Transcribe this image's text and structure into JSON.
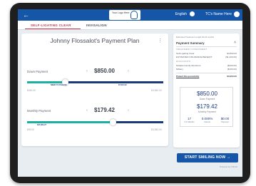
{
  "header": {
    "logo_text": "Your Logo Here",
    "language": "English",
    "user_name": "TC's Name Here"
  },
  "tabs": [
    {
      "label": "SELF-LIGATING CLEAR"
    },
    {
      "label": "INVISALIGN"
    }
  ],
  "plan": {
    "title": "Johnny Flossalot's Payment Plan",
    "down_payment": {
      "label": "Down Payment",
      "value": "$850.00",
      "fill_fraction": 0.28,
      "bar_label_left": "NEED TO PLEASE",
      "bar_label_right": "$7,010.93",
      "min": "$250.00",
      "max": "$3,950.00"
    },
    "monthly_payment": {
      "label": "Monthly Payment",
      "value": "$179.42",
      "fill_fraction": 0.63,
      "bar_label_left": "$47,903.27",
      "min": "$99.00",
      "max": "$3,950.00"
    }
  },
  "summary": {
    "note": "Estimated Treatment Length 18-24 months",
    "title": "Payment Summary",
    "treatment_heading": "TREATMENT INVESTMENT",
    "rows": [
      {
        "label": "Self-Ligating Clear",
        "value": "$3,800.00"
      },
      {
        "label": "ESTIMATED INSURANCE BENEFIT",
        "value": "($1,200.00)"
      }
    ],
    "discounts_heading": "DISCOUNTS",
    "discount_rows": [
      {
        "label": "Multiple Family Members",
        "value": "($100.00)"
      },
      {
        "label": "Military",
        "value": "($150.00)"
      }
    ],
    "patient_responsibility": {
      "label": "Patient Responsibility",
      "value": "$3,900.00"
    },
    "down_amount": "$850.00",
    "down_label": "Down Payment",
    "monthly_amount": "$179.42",
    "monthly_label": "Monthly Payment",
    "stats": [
      {
        "value": "17",
        "label": "# of Months"
      },
      {
        "value": "0.000%",
        "label": "Interest"
      },
      {
        "value": "$0.00",
        "label": "Discount"
      }
    ]
  },
  "cta_label": "START SMILING NOW  →",
  "powered_by": "Powered by OrthoFi",
  "colors": {
    "brand_blue": "#1556a8",
    "accent_red": "#c4364b",
    "teal": "#19b0a2",
    "navy": "#1b3a7a"
  }
}
